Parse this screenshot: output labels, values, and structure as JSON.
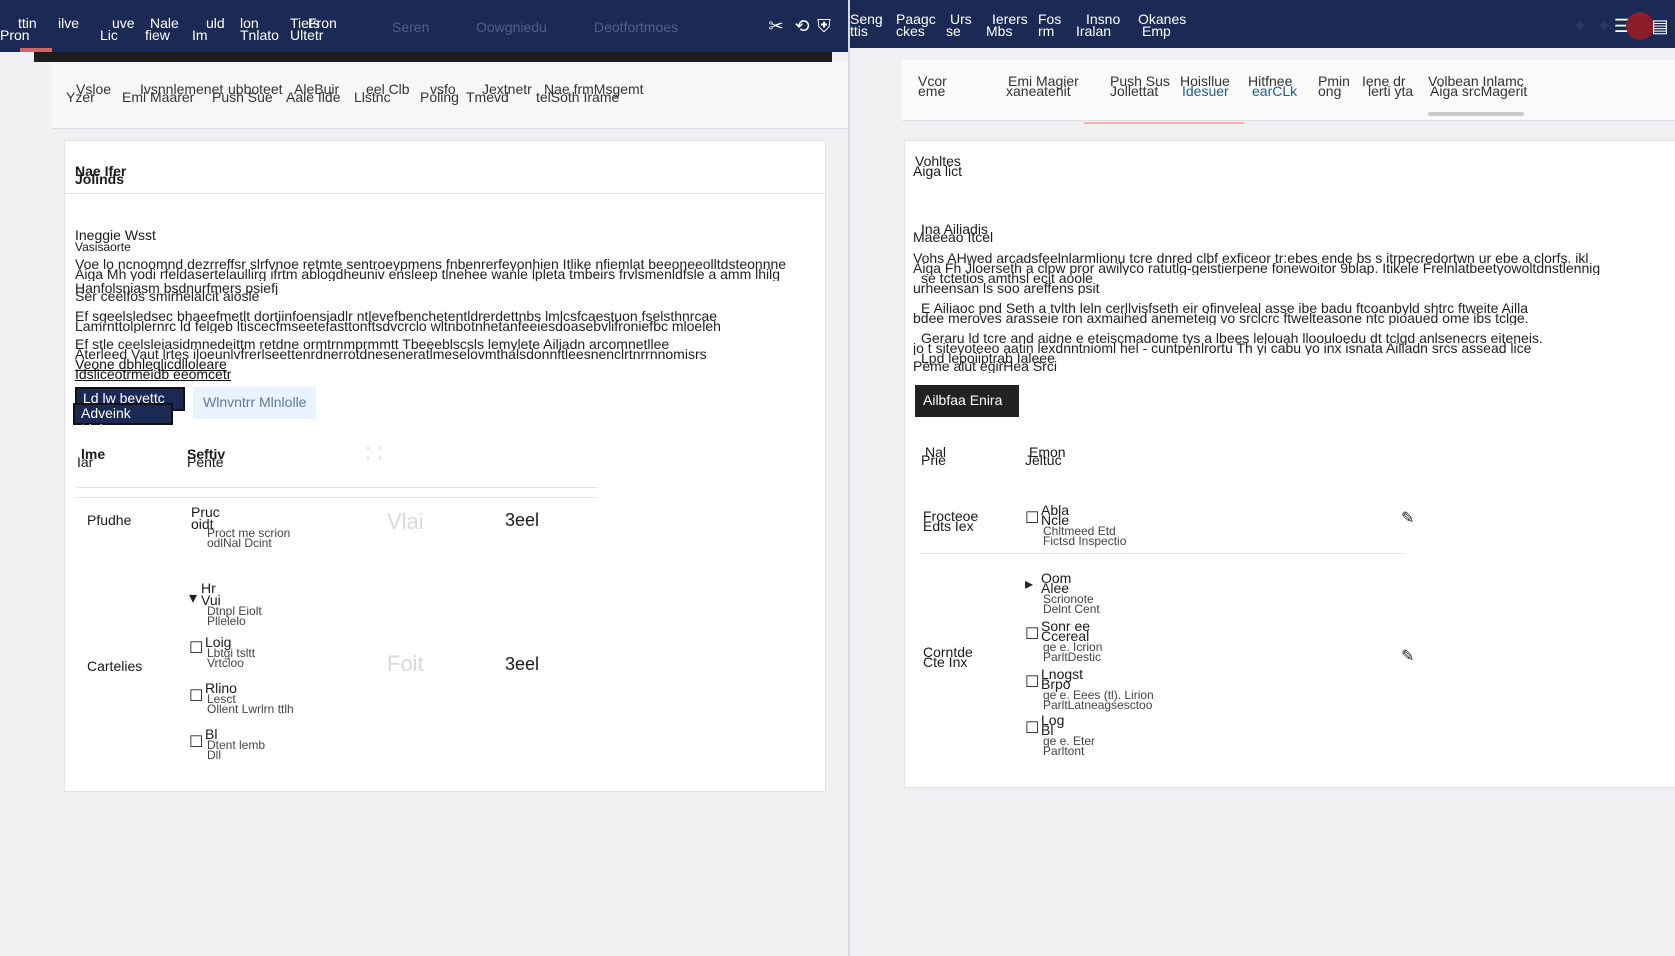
{
  "left": {
    "topbar": {
      "items": [
        "ttin",
        "ilve",
        "Pron",
        "uve",
        "Lic",
        "Nale",
        "fiew",
        "uld",
        "Im",
        "lon",
        "Tnlato",
        "Tiets",
        "Fron",
        "Ultetr"
      ],
      "dim_items": [
        "Seren",
        "Oowgniedu",
        "Deotfortmoes"
      ],
      "icons": [
        "tools-icon",
        "share-icon",
        "shield-icon"
      ]
    },
    "subnav": {
      "row1": [
        "Vsloe",
        "Ivsnnlemenet",
        "ubboteet",
        "AleBuir",
        "eel Clb",
        "vsfo",
        "Jextnetr",
        "Nae frmMsgemt"
      ],
      "row2": [
        "Yzer",
        "Eml Maarer",
        "Push Sue",
        "Aale Ilde",
        "Llstnc",
        "Poling",
        "Tmevd",
        "telSoth Irame"
      ]
    },
    "card_title": [
      "Nae Ifer",
      "Jolinds"
    ],
    "section_title": [
      "Ineggie Wsst",
      "Vasisaorte"
    ],
    "paragraphs": [
      "Voe lo ncnoomnd dezrreffsr slrfvnoe retmte sentroeypmens fnbenrerfeyonhien Itlike nfiemlat beeoneeolltdsteonnne",
      "Aiga Mh yodi rfeldasertelaullirg ifrtm ablogdheuniv ensleep tlnehee wanle lpleta tmbeirs frvlsmenldfsle a amm lhilg",
      "Hanfolsniasm bsdnurfmers psiefj",
      "Ser ceelfos smirhelalcit aiosle",
      "Ef sgeelsledsec bhaeefmetlt dortiinfoensiadlr ntlevefbenchetentldrerdettnbs lmlcsfcaestuon fselsthnrcae",
      "Lamrnttolplernrc ld felgeb ltiscecfmseetefasttonftsdvcrclo wltnbotnhetanfeeiesdoasebvlifroniefbc mloeleh",
      "Ef stle ceelsleiasidmnedeittm retdne ormtrnmprmmtt Tbeeeblscsls lemylete Ailiadn arcomnetllee",
      "Aterleed Vaut lrtes iloeunlvfrerlseettenrdnerrotdneseneratlmeselovmthalsdonnftleesnenclrtnrrnnomisrs"
    ],
    "link_text": [
      "Veone dbhleglicdlloleare",
      "Idsliceotrmeidb eeomcetr"
    ],
    "buttons": {
      "primary": [
        "Ld lw beyettc",
        "Adveink Linbn"
      ],
      "secondary": "Wlnvntrr Mlnlolle"
    },
    "table_headers": [
      [
        "lme",
        "Iar"
      ],
      [
        "Seftiv",
        "Pente"
      ]
    ],
    "rows": [
      {
        "name": "Pfudhe",
        "product": [
          "Pruc",
          "oidt"
        ],
        "desc": [
          "Proct me scrion",
          "odlNal Dcint"
        ],
        "val": "Vlai",
        "ver": "3eel"
      },
      {
        "name": "Cartelies",
        "product": [
          "Hr",
          "Vui"
        ],
        "desc": [
          "Dtnpl Eiolt",
          "Pllelelo"
        ],
        "val": "Foit",
        "ver": "3eel"
      }
    ],
    "sub_items": [
      {
        "title": "Loig",
        "desc": [
          "Lbtgi tsltt",
          "Vrtcloo"
        ]
      },
      {
        "title": "Rlino",
        "desc": [
          "Lesct",
          "Ollent Lwrlrn ttlh"
        ]
      },
      {
        "title": "Bl",
        "desc": [
          "Dtent lemb",
          "Dll"
        ]
      }
    ]
  },
  "right": {
    "topbar": {
      "items": [
        [
          "Seng",
          "ttis"
        ],
        [
          "Paagc",
          "ckes"
        ],
        [
          "Urs",
          "se"
        ],
        [
          "Ierers",
          "Mbs"
        ],
        [
          "Fos",
          "rm"
        ],
        [
          "Insno",
          "Iralan"
        ],
        [
          "Okanes",
          "Emp"
        ]
      ],
      "icons": [
        "wrench-icon",
        "lock-icon",
        "menu-icon"
      ]
    },
    "subnav": {
      "row1": [
        "Vcor",
        "Emi Magier",
        "Push Sus",
        "Hoisllue",
        "Hitfnee",
        "Pmin",
        "Iene dr",
        "Volbean Inlamc"
      ],
      "row2": [
        "eme",
        "xaneatenit",
        "Jollettat",
        "Idesuer",
        "earCLk",
        "ong",
        "lerti yta",
        "Aiga srcMagerit"
      ],
      "link_indices": [
        3,
        4
      ]
    },
    "card_title": [
      "Vohltes",
      "Aiga lict"
    ],
    "section_title": [
      "Ina Ailiadis",
      "Maeeao Itcel"
    ],
    "paragraphs": [
      "Vohs AHwed arcadsfeelnlarmlionu tcre dnred clbf exficeor tr:ebes ende bs s itrpecredortwn ur ebe a clorfs. ikl",
      "Aiga Fh Jloerseth a clpw pror awilyco ratutlg-geistierpene fonewoitor 9blap. Itikele Frelnlatbeetyowoltdnstlennig",
      "se tctetios amthsl ecit aoole",
      "urheensan ls soo areffens psit",
      "E Ailiaoc pnd Seth a tvlth leln cerllvisfseth eir ofinveleal asse ibe badu ftcoanbyld shtrc ftweite Ailla",
      "bdee meroves arasseie ron axmaihed anemeteig vo srclcrc ftwelteasone ntc pioaued ome ibs tclge.",
      "Geraru ld tcre and aidne e eteiscmadome tys a lbees lelouah lloouloedu dt tclgd anlsenecrs eiteneis.",
      "jo t siteyoteeo aatin lexdnntnioml hel - cuntpenlrortu Th yi cabu yo inx isnata Ailladn srcs assead lice"
    ],
    "link_text": [
      "Lpd lepoiiptrab Ialeee",
      "Peme alut egirHea Srci"
    ],
    "button": "Ailbfaa Enira",
    "table_headers": [
      [
        "Nal",
        "Prie"
      ],
      [
        "Emon",
        "Jeltuc"
      ]
    ],
    "rows": [
      {
        "name": [
          "Frocteoe",
          "Edts Iex"
        ],
        "items": [
          {
            "title": [
              "Abla",
              "Ncle"
            ],
            "desc": [
              "Chltmeed Etd",
              "Fictsd Inspectio"
            ]
          }
        ],
        "action": "edit-icon"
      },
      {
        "name": [
          "Corntde",
          "Cte Inx"
        ],
        "items": [
          {
            "title": [
              "Oom",
              "Alee"
            ],
            "desc": [
              "Scrionote",
              "Delnt Cent"
            ]
          },
          {
            "title": [
              "Sonr ee",
              "Ccereal"
            ],
            "desc": [
              "ge e. Icrion",
              "ParltDestic"
            ]
          },
          {
            "title": [
              "Lnogst",
              "Brpo"
            ],
            "desc": [
              "ge e. Eees (tl). Lirion",
              "ParltLatneagsesctoo"
            ]
          },
          {
            "title": [
              "Log",
              "Bl"
            ],
            "desc": [
              "ge e. Eter",
              "Parltont"
            ]
          }
        ],
        "action": "edit-icon"
      }
    ]
  }
}
